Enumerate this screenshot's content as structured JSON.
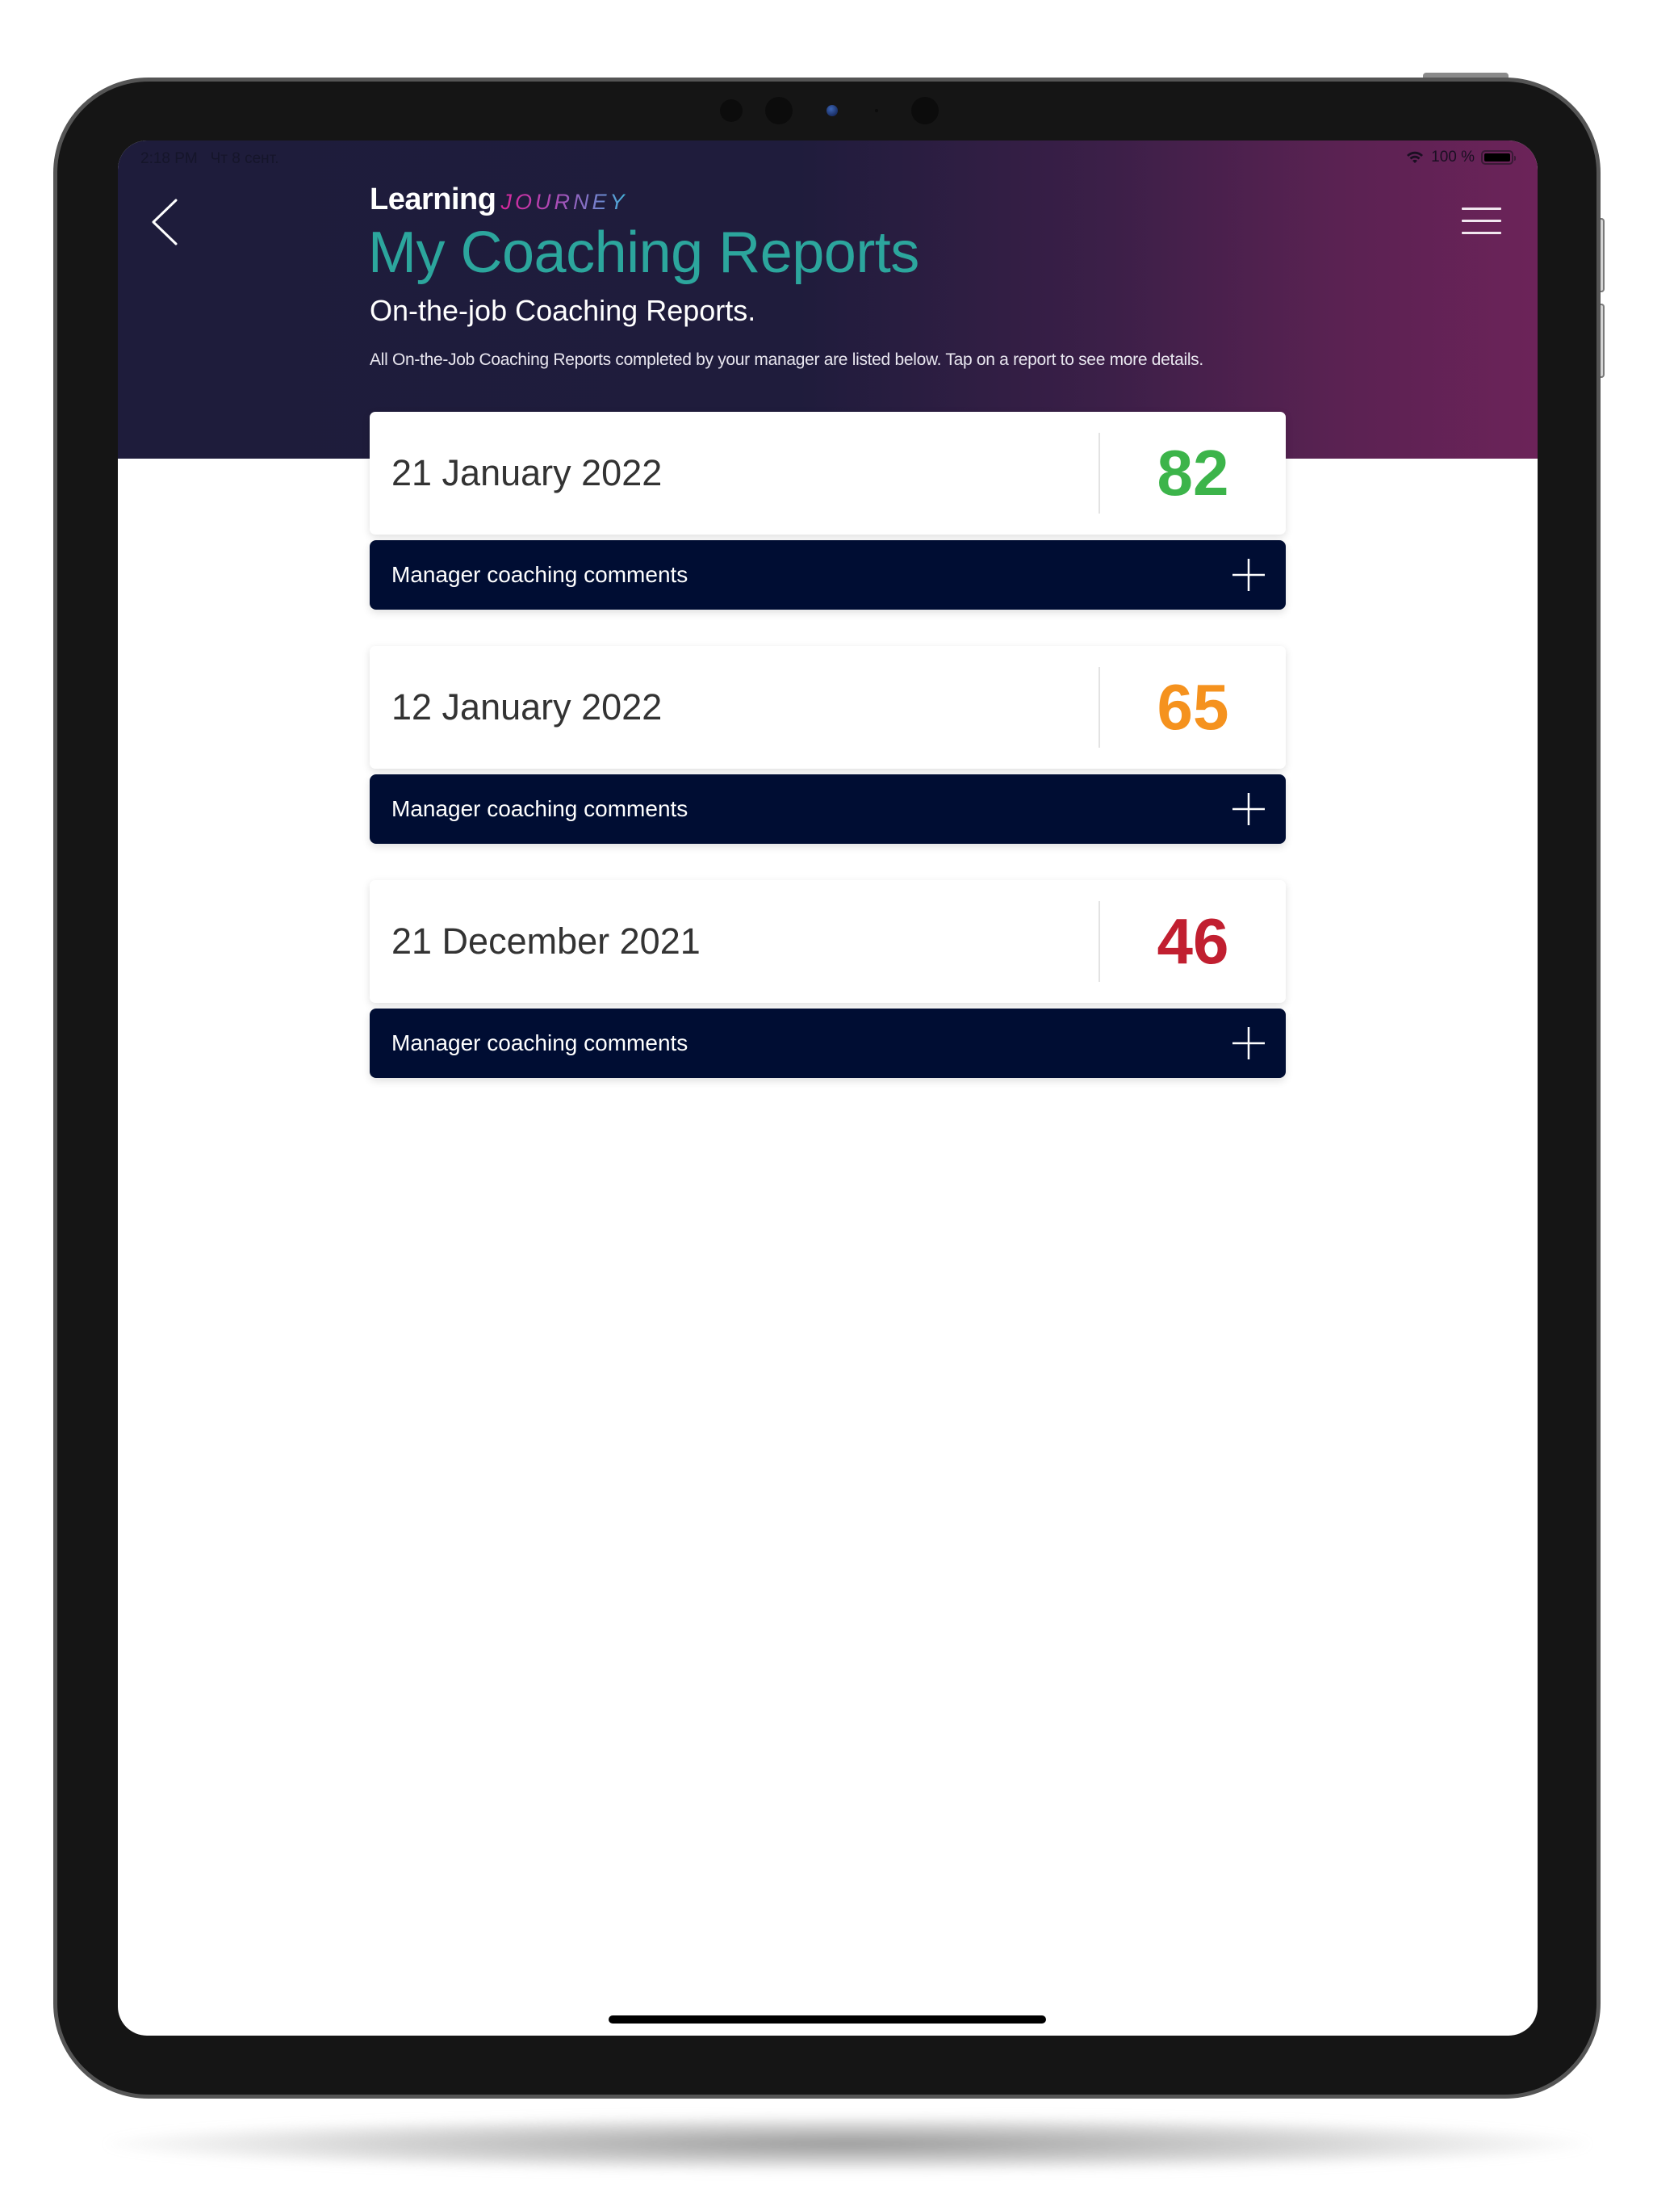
{
  "status_bar": {
    "time": "2:18 PM",
    "date": "Чт 8 сент.",
    "battery_text": "100 %",
    "battery_level": 1.0,
    "wifi_icon": "wifi-icon",
    "battery_icon": "battery-icon"
  },
  "header": {
    "back_icon": "chevron-left-icon",
    "menu_icon": "hamburger-menu-icon",
    "brand_primary": "Learning",
    "brand_secondary": "JOURNEY",
    "title": "My Coaching Reports",
    "subtitle": "On-the-job Coaching Reports.",
    "description": "All On-the-Job Coaching Reports completed by your manager are listed below. Tap on a report to see more details."
  },
  "colors": {
    "title": "#2ca69d",
    "score_high": "#3cb44a",
    "score_mid": "#f5921e",
    "score_low": "#c11f30",
    "comments_bar": "#000d33",
    "header_gradient_start": "#1e1c3b",
    "header_gradient_end": "#6c2359"
  },
  "reports": [
    {
      "date": "21 January 2022",
      "score": "82",
      "score_level": "high",
      "comments_label": "Manager coaching comments",
      "expand_icon": "plus-icon"
    },
    {
      "date": "12 January 2022",
      "score": "65",
      "score_level": "mid",
      "comments_label": "Manager coaching comments",
      "expand_icon": "plus-icon"
    },
    {
      "date": "21 December 2021",
      "score": "46",
      "score_level": "low",
      "comments_label": "Manager coaching comments",
      "expand_icon": "plus-icon"
    }
  ]
}
